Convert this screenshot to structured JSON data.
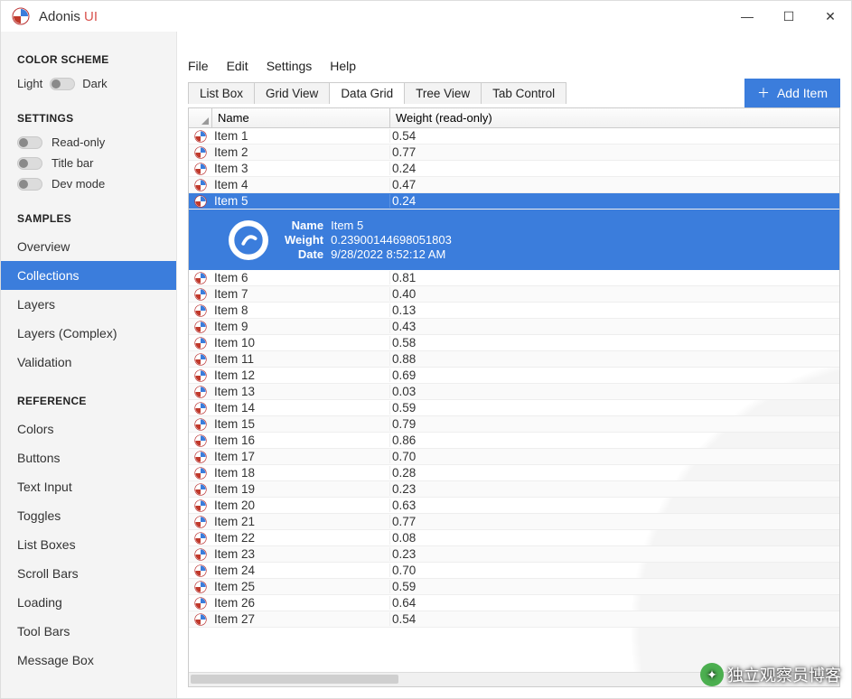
{
  "title": {
    "a": "Adonis ",
    "b": "UI"
  },
  "window_controls": {
    "min": "—",
    "max": "☐",
    "close": "✕"
  },
  "sidebar": {
    "scheme_title": "COLOR SCHEME",
    "scheme_left": "Light",
    "scheme_right": "Dark",
    "settings_title": "SETTINGS",
    "settings": [
      {
        "label": "Read-only"
      },
      {
        "label": "Title bar"
      },
      {
        "label": "Dev mode"
      }
    ],
    "samples_title": "SAMPLES",
    "samples": [
      "Overview",
      "Collections",
      "Layers",
      "Layers (Complex)",
      "Validation"
    ],
    "selected_sample": 1,
    "reference_title": "REFERENCE",
    "reference": [
      "Colors",
      "Buttons",
      "Text Input",
      "Toggles",
      "List Boxes",
      "Scroll Bars",
      "Loading",
      "Tool Bars",
      "Message Box"
    ]
  },
  "menubar": [
    "File",
    "Edit",
    "Settings",
    "Help"
  ],
  "tabs": [
    "List Box",
    "Grid View",
    "Data Grid",
    "Tree View",
    "Tab Control"
  ],
  "active_tab": 2,
  "add_button": "Add Item",
  "grid": {
    "col_name": "Name",
    "col_weight": "Weight (read-only)",
    "selected": 4,
    "rows": [
      {
        "name": "Item 1",
        "weight": "0.54"
      },
      {
        "name": "Item 2",
        "weight": "0.77"
      },
      {
        "name": "Item 3",
        "weight": "0.24"
      },
      {
        "name": "Item 4",
        "weight": "0.47"
      },
      {
        "name": "Item 5",
        "weight": "0.24"
      },
      {
        "name": "Item 6",
        "weight": "0.81"
      },
      {
        "name": "Item 7",
        "weight": "0.40"
      },
      {
        "name": "Item 8",
        "weight": "0.13"
      },
      {
        "name": "Item 9",
        "weight": "0.43"
      },
      {
        "name": "Item 10",
        "weight": "0.58"
      },
      {
        "name": "Item 11",
        "weight": "0.88"
      },
      {
        "name": "Item 12",
        "weight": "0.69"
      },
      {
        "name": "Item 13",
        "weight": "0.03"
      },
      {
        "name": "Item 14",
        "weight": "0.59"
      },
      {
        "name": "Item 15",
        "weight": "0.79"
      },
      {
        "name": "Item 16",
        "weight": "0.86"
      },
      {
        "name": "Item 17",
        "weight": "0.70"
      },
      {
        "name": "Item 18",
        "weight": "0.28"
      },
      {
        "name": "Item 19",
        "weight": "0.23"
      },
      {
        "name": "Item 20",
        "weight": "0.63"
      },
      {
        "name": "Item 21",
        "weight": "0.77"
      },
      {
        "name": "Item 22",
        "weight": "0.08"
      },
      {
        "name": "Item 23",
        "weight": "0.23"
      },
      {
        "name": "Item 24",
        "weight": "0.70"
      },
      {
        "name": "Item 25",
        "weight": "0.59"
      },
      {
        "name": "Item 26",
        "weight": "0.64"
      },
      {
        "name": "Item 27",
        "weight": "0.54"
      }
    ]
  },
  "detail": {
    "name_k": "Name",
    "name_v": "Item 5",
    "weight_k": "Weight",
    "weight_v": "0.23900144698051803",
    "date_k": "Date",
    "date_v": "9/28/2022 8:52:12 AM"
  },
  "watermark": "独立观察员博客"
}
